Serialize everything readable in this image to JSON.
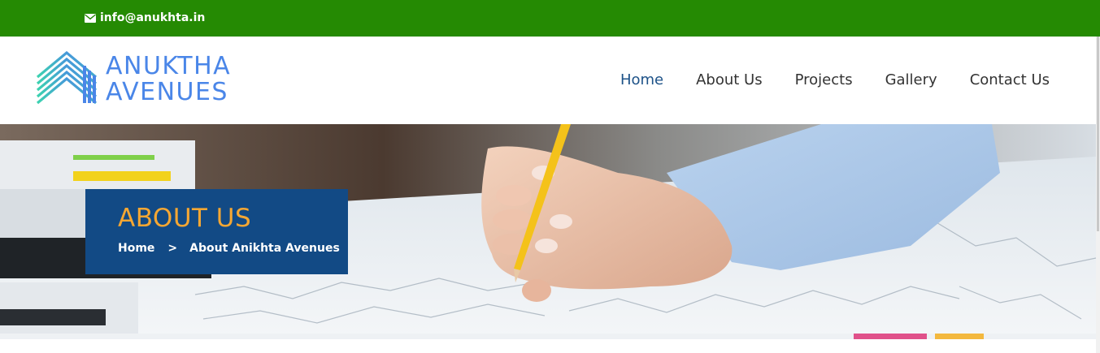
{
  "topbar": {
    "email": "info@anukhta.in",
    "background_color": "#258a03"
  },
  "logo": {
    "line1": "ANUKTHA",
    "line2": "AVENUES",
    "text_color": "#4a86e8"
  },
  "nav": {
    "items": [
      {
        "label": "Home",
        "active": true
      },
      {
        "label": "About Us",
        "active": false
      },
      {
        "label": "Projects",
        "active": false
      },
      {
        "label": "Gallery",
        "active": false
      },
      {
        "label": "Contact Us",
        "active": false
      }
    ],
    "active_color": "#1d5288"
  },
  "hero": {
    "title": "ABOUT US",
    "breadcrumb": {
      "home": "Home",
      "separator": ">",
      "current": "About Anikhta Avenues"
    },
    "box_color": "#124a85",
    "title_color": "#f5a733"
  },
  "icons": {
    "email": "envelope-icon",
    "logo": "building-chevron-logo-icon",
    "breadcrumb_separator": "chevron-right-icon"
  }
}
